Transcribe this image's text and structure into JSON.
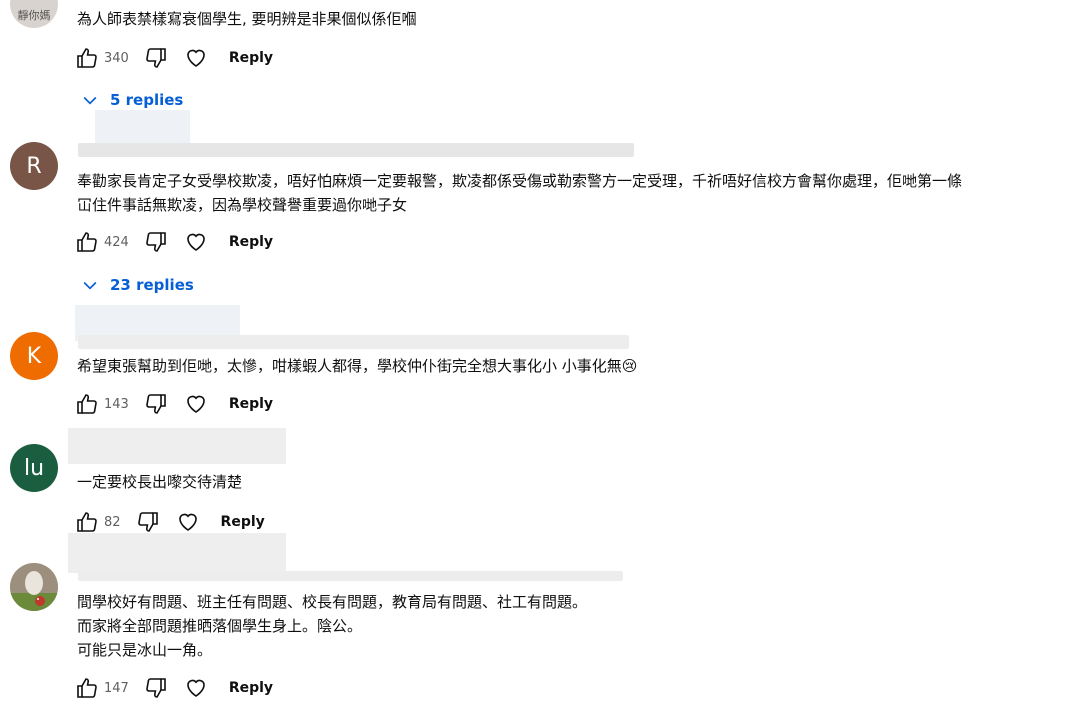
{
  "comments": [
    {
      "avatar_letter": "靜你媽",
      "avatar_color": "#d9d3cf",
      "text": "為人師表禁樣寫衰個學生, 要明辨是非果個似係佢嗰",
      "likes": "340",
      "reply_label": "Reply",
      "replies_label": "5 replies"
    },
    {
      "avatar_letter": "R",
      "avatar_color": "#795548",
      "text": "奉勸家長肯定子女受學校欺凌，唔好怕麻煩一定要報警，欺凌都係受傷或勒索警方一定受理，千祈唔好信校方會幫你處理，佢哋第一條\n冚住件事話無欺凌，因為學校聲譽重要過你哋子女",
      "likes": "424",
      "reply_label": "Reply",
      "replies_label": "23 replies"
    },
    {
      "avatar_letter": "K",
      "avatar_color": "#ef6c00",
      "text": "希望東張幫助到佢哋，太慘，咁樣蝦人都得，學校仲仆街完全想大事化小 小事化無😢",
      "likes": "143",
      "reply_label": "Reply"
    },
    {
      "avatar_letter": "lu",
      "avatar_color": "#1b5e3f",
      "text": "一定要校長出嚟交待清楚",
      "likes": "82",
      "reply_label": "Reply"
    },
    {
      "avatar_letter": "",
      "avatar_color": "#a89c8c",
      "text": "間學校好有問題、班主任有問題、校長有問題，教育局有問題、社工有問題。\n而家將全部問題推晒落個學生身上。陰公。\n可能只是冰山一角。",
      "likes": "147",
      "reply_label": "Reply"
    }
  ]
}
